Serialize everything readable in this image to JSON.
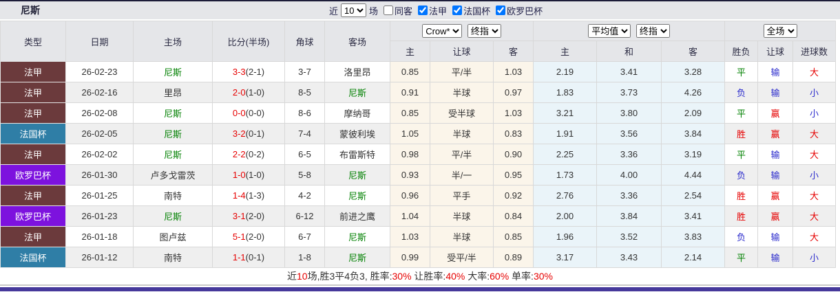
{
  "header": {
    "team": "尼斯",
    "recent_label": "近",
    "recent_count": "10",
    "matches_label": "场",
    "same_venue_label": "同客",
    "filters": [
      {
        "label": "法甲",
        "checked": true
      },
      {
        "label": "法国杯",
        "checked": true
      },
      {
        "label": "欧罗巴杯",
        "checked": true
      }
    ]
  },
  "table": {
    "columns": {
      "type": "类型",
      "date": "日期",
      "home": "主场",
      "score": "比分(半场)",
      "corner": "角球",
      "away": "客场",
      "odds_sub": [
        "主",
        "让球",
        "客"
      ],
      "avg_sub": [
        "主",
        "和",
        "客"
      ],
      "result_sub": [
        "胜负",
        "让球",
        "进球数"
      ]
    },
    "selects": {
      "bookmaker": "Crow*",
      "bookmaker_stage": "终指",
      "average": "平均值",
      "average_stage": "终指",
      "scope": "全场"
    },
    "league_colors": {
      "法甲": "#6b3a3c",
      "法国杯": "#2f7ea6",
      "欧罗巴杯": "#7d12de"
    },
    "outcome_colors": {
      "胜": "#e60000",
      "平": "#008000",
      "负": "#2b2bcc",
      "赢": "#e60000",
      "输": "#2b2bcc",
      "大": "#e60000",
      "小": "#2b2bcc"
    },
    "rows": [
      {
        "league": "法甲",
        "date": "26-02-23",
        "home": "尼斯",
        "score": "3-3",
        "half": "(2-1)",
        "corner": "3-7",
        "away": "洛里昂",
        "odds": [
          "0.85",
          "平/半",
          "1.03"
        ],
        "avg": [
          "2.19",
          "3.41",
          "3.28"
        ],
        "result": "平",
        "handicap_result": "输",
        "goals_result": "大"
      },
      {
        "league": "法甲",
        "date": "26-02-16",
        "home": "里昂",
        "score": "2-0",
        "half": "(1-0)",
        "corner": "8-5",
        "away": "尼斯",
        "odds": [
          "0.91",
          "半球",
          "0.97"
        ],
        "avg": [
          "1.83",
          "3.73",
          "4.26"
        ],
        "result": "负",
        "handicap_result": "输",
        "goals_result": "小"
      },
      {
        "league": "法甲",
        "date": "26-02-08",
        "home": "尼斯",
        "score": "0-0",
        "half": "(0-0)",
        "corner": "8-6",
        "away": "摩纳哥",
        "odds": [
          "0.85",
          "受半球",
          "1.03"
        ],
        "avg": [
          "3.21",
          "3.80",
          "2.09"
        ],
        "result": "平",
        "handicap_result": "赢",
        "goals_result": "小"
      },
      {
        "league": "法国杯",
        "date": "26-02-05",
        "home": "尼斯",
        "score": "3-2",
        "half": "(0-1)",
        "corner": "7-4",
        "away": "蒙彼利埃",
        "odds": [
          "1.05",
          "半球",
          "0.83"
        ],
        "avg": [
          "1.91",
          "3.56",
          "3.84"
        ],
        "result": "胜",
        "handicap_result": "赢",
        "goals_result": "大"
      },
      {
        "league": "法甲",
        "date": "26-02-02",
        "home": "尼斯",
        "score": "2-2",
        "half": "(0-2)",
        "corner": "6-5",
        "away": "布雷斯特",
        "odds": [
          "0.98",
          "平/半",
          "0.90"
        ],
        "avg": [
          "2.25",
          "3.36",
          "3.19"
        ],
        "result": "平",
        "handicap_result": "输",
        "goals_result": "大"
      },
      {
        "league": "欧罗巴杯",
        "date": "26-01-30",
        "home": "卢多戈雷茨",
        "score": "1-0",
        "half": "(1-0)",
        "corner": "5-8",
        "away": "尼斯",
        "odds": [
          "0.93",
          "半/一",
          "0.95"
        ],
        "avg": [
          "1.73",
          "4.00",
          "4.44"
        ],
        "result": "负",
        "handicap_result": "输",
        "goals_result": "小"
      },
      {
        "league": "法甲",
        "date": "26-01-25",
        "home": "南特",
        "score": "1-4",
        "half": "(1-3)",
        "corner": "4-2",
        "away": "尼斯",
        "odds": [
          "0.96",
          "平手",
          "0.92"
        ],
        "avg": [
          "2.76",
          "3.36",
          "2.54"
        ],
        "result": "胜",
        "handicap_result": "赢",
        "goals_result": "大"
      },
      {
        "league": "欧罗巴杯",
        "date": "26-01-23",
        "home": "尼斯",
        "score": "3-1",
        "half": "(2-0)",
        "corner": "6-12",
        "away": "前进之鹰",
        "odds": [
          "1.04",
          "半球",
          "0.84"
        ],
        "avg": [
          "2.00",
          "3.84",
          "3.41"
        ],
        "result": "胜",
        "handicap_result": "赢",
        "goals_result": "大"
      },
      {
        "league": "法甲",
        "date": "26-01-18",
        "home": "图卢兹",
        "score": "5-1",
        "half": "(2-0)",
        "corner": "6-7",
        "away": "尼斯",
        "odds": [
          "1.03",
          "半球",
          "0.85"
        ],
        "avg": [
          "1.96",
          "3.52",
          "3.83"
        ],
        "result": "负",
        "handicap_result": "输",
        "goals_result": "大"
      },
      {
        "league": "法国杯",
        "date": "26-01-12",
        "home": "南特",
        "score": "1-1",
        "half": "(0-1)",
        "corner": "1-8",
        "away": "尼斯",
        "odds": [
          "0.99",
          "受平/半",
          "0.89"
        ],
        "avg": [
          "3.17",
          "3.43",
          "2.14"
        ],
        "result": "平",
        "handicap_result": "输",
        "goals_result": "小"
      }
    ]
  },
  "footer": {
    "segments": [
      {
        "text": "近",
        "red": false
      },
      {
        "text": "10",
        "red": true
      },
      {
        "text": "场,胜3平4负3, 胜率:",
        "red": false
      },
      {
        "text": "30%",
        "red": true
      },
      {
        "text": " 让胜率:",
        "red": false
      },
      {
        "text": "40%",
        "red": true
      },
      {
        "text": " 大率:",
        "red": false
      },
      {
        "text": "60%",
        "red": true
      },
      {
        "text": " 单率:",
        "red": false
      },
      {
        "text": "30%",
        "red": true
      }
    ]
  }
}
